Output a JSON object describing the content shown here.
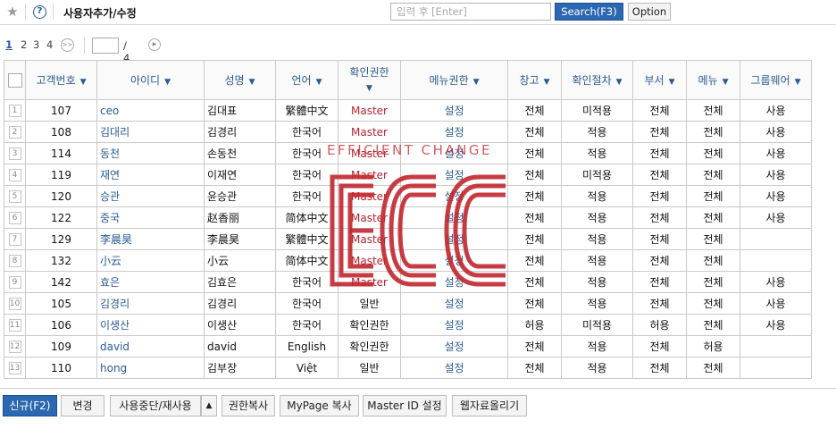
{
  "header": {
    "title": "사용자추가/수정",
    "search_placeholder": "입력 후 [Enter]",
    "search_button": "Search(F3)",
    "option_button": "Option"
  },
  "pagination": {
    "pages": [
      "1",
      "2",
      "3",
      "4"
    ],
    "active_page": "1",
    "current_value": "",
    "total": "/ 4"
  },
  "table": {
    "columns": [
      "고객번호",
      "아이디",
      "성명",
      "언어",
      "확인권한",
      "메뉴권한",
      "창고",
      "확인절차",
      "부서",
      "메뉴",
      "그룹웨어"
    ],
    "rows": [
      {
        "no": "1",
        "cust": "107",
        "id": "ceo",
        "name": "김대표",
        "lang": "繁體中文",
        "confirm": "Master",
        "menu_perm": "설정",
        "warehouse": "전체",
        "procedure": "미적용",
        "dept": "전체",
        "menu": "전체",
        "groupware": "사용"
      },
      {
        "no": "2",
        "cust": "108",
        "id": "김대리",
        "name": "김경리",
        "lang": "한국어",
        "confirm": "Master",
        "menu_perm": "설정",
        "warehouse": "전체",
        "procedure": "적용",
        "dept": "전체",
        "menu": "전체",
        "groupware": "사용"
      },
      {
        "no": "3",
        "cust": "114",
        "id": "동천",
        "name": "손동천",
        "lang": "한국어",
        "confirm": "Master",
        "menu_perm": "설정",
        "warehouse": "전체",
        "procedure": "적용",
        "dept": "전체",
        "menu": "전체",
        "groupware": "사용"
      },
      {
        "no": "4",
        "cust": "119",
        "id": "재연",
        "name": "이재연",
        "lang": "한국어",
        "confirm": "Master",
        "menu_perm": "설정",
        "warehouse": "전체",
        "procedure": "미적용",
        "dept": "전체",
        "menu": "전체",
        "groupware": "사용"
      },
      {
        "no": "5",
        "cust": "120",
        "id": "승관",
        "name": "윤승관",
        "lang": "한국어",
        "confirm": "Master",
        "menu_perm": "설정",
        "warehouse": "전체",
        "procedure": "적용",
        "dept": "전체",
        "menu": "전체",
        "groupware": "사용"
      },
      {
        "no": "6",
        "cust": "122",
        "id": "중국",
        "name": "赵香丽",
        "lang": "简体中文",
        "confirm": "Master",
        "menu_perm": "설정",
        "warehouse": "전체",
        "procedure": "적용",
        "dept": "전체",
        "menu": "전체",
        "groupware": "사용"
      },
      {
        "no": "7",
        "cust": "129",
        "id": "李晨昊",
        "name": "李晨昊",
        "lang": "繁體中文",
        "confirm": "Master",
        "menu_perm": "설정",
        "warehouse": "전체",
        "procedure": "적용",
        "dept": "전체",
        "menu": "전체",
        "groupware": ""
      },
      {
        "no": "8",
        "cust": "132",
        "id": "小云",
        "name": "小云",
        "lang": "简体中文",
        "confirm": "Master",
        "menu_perm": "설정",
        "warehouse": "전체",
        "procedure": "적용",
        "dept": "전체",
        "menu": "전체",
        "groupware": ""
      },
      {
        "no": "9",
        "cust": "142",
        "id": "효은",
        "name": "김효은",
        "lang": "한국어",
        "confirm": "Master",
        "menu_perm": "설정",
        "warehouse": "전체",
        "procedure": "적용",
        "dept": "전체",
        "menu": "전체",
        "groupware": "사용"
      },
      {
        "no": "10",
        "cust": "105",
        "id": "김경리",
        "name": "김경리",
        "lang": "한국어",
        "confirm": "일반",
        "menu_perm": "설정",
        "warehouse": "전체",
        "procedure": "적용",
        "dept": "전체",
        "menu": "전체",
        "groupware": "사용"
      },
      {
        "no": "11",
        "cust": "106",
        "id": "이생산",
        "name": "이생산",
        "lang": "한국어",
        "confirm": "확인권한",
        "menu_perm": "설정",
        "warehouse": "허용",
        "procedure": "미적용",
        "dept": "허용",
        "menu": "전체",
        "groupware": "사용"
      },
      {
        "no": "12",
        "cust": "109",
        "id": "david",
        "name": "david",
        "lang": "English",
        "confirm": "확인권한",
        "menu_perm": "설정",
        "warehouse": "전체",
        "procedure": "적용",
        "dept": "전체",
        "menu": "허용",
        "groupware": ""
      },
      {
        "no": "13",
        "cust": "110",
        "id": "hong",
        "name": "김부장",
        "lang": "Việt",
        "confirm": "일반",
        "menu_perm": "설정",
        "warehouse": "전체",
        "procedure": "적용",
        "dept": "전체",
        "menu": "전체",
        "groupware": ""
      }
    ]
  },
  "watermark": {
    "text": "EFFICIENT CHANGE",
    "color": "#c1272d"
  },
  "footer": {
    "new": "신규(F2)",
    "edit": "변경",
    "suspend": "사용중단/재사용",
    "copy_perm": "권한복사",
    "mypage_copy": "MyPage 복사",
    "master_id": "Master ID 설정",
    "upload": "웹자료올리기"
  },
  "colors": {
    "accent": "#2c67b2",
    "link": "#2a5a93",
    "master": "#b42330"
  }
}
